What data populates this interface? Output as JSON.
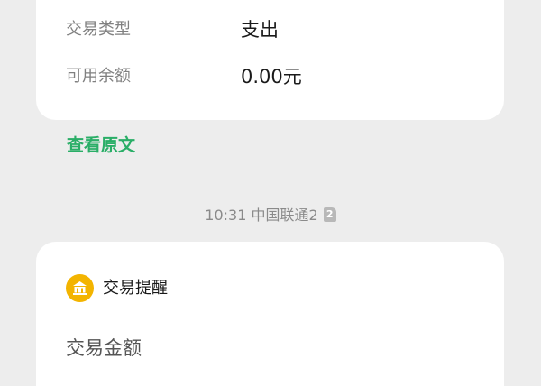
{
  "summary_card": {
    "rows": [
      {
        "label": "交易类型",
        "value": "支出"
      },
      {
        "label": "可用余额",
        "value": "0.00元"
      }
    ]
  },
  "view_original_link": "查看原文",
  "message_meta": {
    "time": "10:31",
    "carrier": "中国联通2",
    "sim_badge": "2"
  },
  "notification_card": {
    "icon": "bank-icon",
    "title": "交易提醒",
    "amount_label": "交易金额"
  },
  "colors": {
    "accent_green": "#2aae67",
    "icon_yellow": "#f3b400",
    "background": "#ededed"
  }
}
